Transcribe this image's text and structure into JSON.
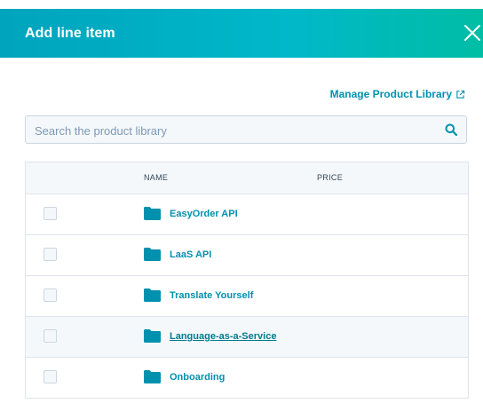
{
  "dialog": {
    "title": "Add line item",
    "close_icon": "close-icon"
  },
  "manage_link": {
    "label": "Manage Product Library",
    "icon": "external-link-icon"
  },
  "search": {
    "placeholder": "Search the product library",
    "value": "",
    "icon": "search-icon"
  },
  "table": {
    "headers": {
      "name": "NAME",
      "price": "PRICE"
    },
    "rows": [
      {
        "name": "EasyOrder API",
        "type": "folder",
        "checked": false
      },
      {
        "name": "LaaS API",
        "type": "folder",
        "checked": false
      },
      {
        "name": "Translate Yourself",
        "type": "folder",
        "checked": false
      },
      {
        "name": "Language-as-a-Service",
        "type": "folder",
        "checked": false,
        "hovered": true
      },
      {
        "name": "Onboarding",
        "type": "folder",
        "checked": false
      }
    ]
  },
  "colors": {
    "accent": "#0091ae",
    "header_start": "#00a4bd",
    "header_end": "#00bda5",
    "border": "#dfe3eb"
  }
}
